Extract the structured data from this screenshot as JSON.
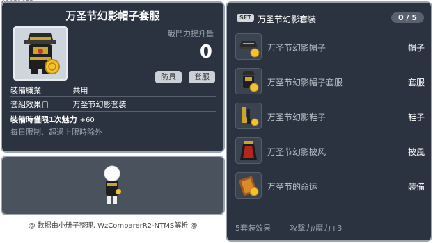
{
  "item_id": "01052675",
  "item": {
    "title": "万圣节幻影帽子套服",
    "power_label": "戰鬥力提升量",
    "power_value": "0",
    "tags": [
      "防具",
      "套服"
    ],
    "job_label": "裝備職業",
    "job_value": "共用",
    "set_effect_label": "套組效果",
    "set_effect_value": "万圣节幻影套装",
    "limit_title": "裝備時僅限1次魅力",
    "limit_plus": "+60",
    "limit_note": "每日限制、超過上限時除外"
  },
  "credit": "@ 数据由小册子整理, WzComparerR2-NTMS解析 @",
  "set": {
    "badge": "SET",
    "name": "万圣节幻影套装",
    "count": "0 / 5",
    "items": [
      {
        "name": "万圣节幻影帽子",
        "slot": "帽子",
        "icon": "hat-icon"
      },
      {
        "name": "万圣节幻影帽子套服",
        "slot": "套服",
        "icon": "outfit-icon"
      },
      {
        "name": "万圣节幻影鞋子",
        "slot": "鞋子",
        "icon": "shoes-icon"
      },
      {
        "name": "万圣节幻影披风",
        "slot": "披風",
        "icon": "cape-icon"
      },
      {
        "name": "万圣节的命运",
        "slot": "裝備",
        "icon": "card-icon"
      }
    ],
    "effect_label": "5套裝效果",
    "effect_value": "攻擊力/魔力+3"
  },
  "colors": {
    "panel": "#2b3340",
    "border": "#9aa3af",
    "coin": "#f2c230"
  }
}
